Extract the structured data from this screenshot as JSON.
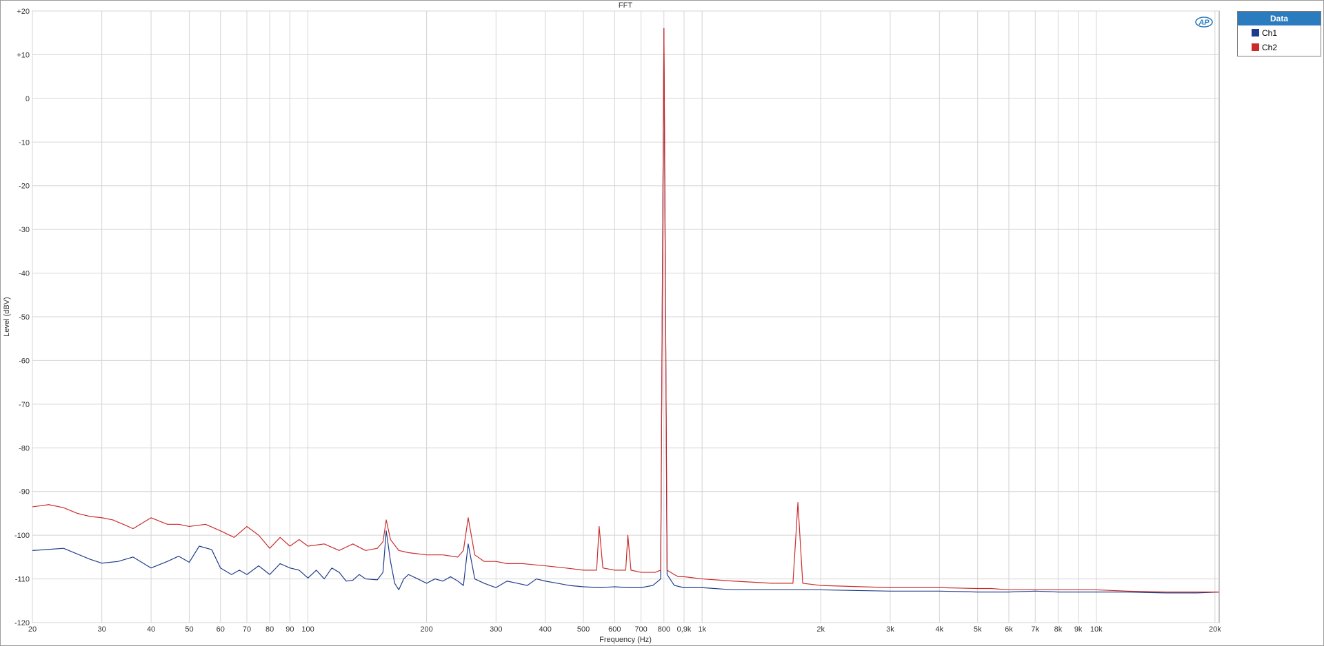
{
  "chart_data": {
    "type": "line",
    "title": "FFT",
    "xlabel": "Frequency (Hz)",
    "ylabel": "Level (dBV)",
    "x_scale": "log",
    "xlim": [
      20,
      20500
    ],
    "ylim": [
      -120,
      20
    ],
    "grid": true,
    "legend_position": "top-right-outside",
    "legend_title": "Data",
    "x_ticks": [
      {
        "value": 20,
        "label": "20"
      },
      {
        "value": 30,
        "label": "30"
      },
      {
        "value": 40,
        "label": "40"
      },
      {
        "value": 50,
        "label": "50"
      },
      {
        "value": 60,
        "label": "60"
      },
      {
        "value": 70,
        "label": "70"
      },
      {
        "value": 80,
        "label": "80"
      },
      {
        "value": 90,
        "label": "90"
      },
      {
        "value": 100,
        "label": "100"
      },
      {
        "value": 200,
        "label": "200"
      },
      {
        "value": 300,
        "label": "300"
      },
      {
        "value": 400,
        "label": "400"
      },
      {
        "value": 500,
        "label": "500"
      },
      {
        "value": 600,
        "label": "600"
      },
      {
        "value": 700,
        "label": "700"
      },
      {
        "value": 800,
        "label": "800"
      },
      {
        "value": 900,
        "label": "0,9k"
      },
      {
        "value": 1000,
        "label": "1k"
      },
      {
        "value": 2000,
        "label": "2k"
      },
      {
        "value": 3000,
        "label": "3k"
      },
      {
        "value": 4000,
        "label": "4k"
      },
      {
        "value": 5000,
        "label": "5k"
      },
      {
        "value": 6000,
        "label": "6k"
      },
      {
        "value": 7000,
        "label": "7k"
      },
      {
        "value": 8000,
        "label": "8k"
      },
      {
        "value": 9000,
        "label": "9k"
      },
      {
        "value": 10000,
        "label": "10k"
      },
      {
        "value": 20000,
        "label": "20k"
      }
    ],
    "y_ticks": [
      {
        "value": 20,
        "label": "+20"
      },
      {
        "value": 10,
        "label": "+10"
      },
      {
        "value": 0,
        "label": "0"
      },
      {
        "value": -10,
        "label": "-10"
      },
      {
        "value": -20,
        "label": "-20"
      },
      {
        "value": -30,
        "label": "-30"
      },
      {
        "value": -40,
        "label": "-40"
      },
      {
        "value": -50,
        "label": "-50"
      },
      {
        "value": -60,
        "label": "-60"
      },
      {
        "value": -70,
        "label": "-70"
      },
      {
        "value": -80,
        "label": "-80"
      },
      {
        "value": -90,
        "label": "-90"
      },
      {
        "value": -100,
        "label": "-100"
      },
      {
        "value": -110,
        "label": "-110"
      },
      {
        "value": -120,
        "label": "-120"
      }
    ],
    "series": [
      {
        "name": "Ch1",
        "color": "#1f3a8a",
        "x": [
          20,
          24,
          28,
          30,
          33,
          36,
          40,
          44,
          47,
          50,
          53,
          57,
          60,
          64,
          67,
          70,
          75,
          80,
          85,
          90,
          95,
          100,
          105,
          110,
          115,
          120,
          125,
          130,
          135,
          140,
          150,
          155,
          158,
          162,
          166,
          170,
          175,
          180,
          190,
          200,
          210,
          220,
          230,
          240,
          248,
          255,
          265,
          280,
          300,
          320,
          340,
          360,
          380,
          400,
          430,
          460,
          500,
          550,
          600,
          650,
          700,
          750,
          785,
          800,
          815,
          850,
          900,
          1000,
          1200,
          1500,
          2000,
          3000,
          4000,
          5000,
          6000,
          7000,
          8000,
          9000,
          10000,
          12000,
          15000,
          18000,
          20500
        ],
        "y": [
          -103.5,
          -103.0,
          -105.5,
          -106.4,
          -106.0,
          -105.0,
          -107.5,
          -106.0,
          -104.8,
          -106.2,
          -102.5,
          -103.3,
          -107.5,
          -109.0,
          -108.0,
          -109.0,
          -107.0,
          -109.0,
          -106.5,
          -107.5,
          -108.0,
          -109.8,
          -108.0,
          -110.0,
          -107.5,
          -108.5,
          -110.5,
          -110.3,
          -109.0,
          -110.0,
          -110.2,
          -108.5,
          -99.0,
          -106.0,
          -111.0,
          -112.5,
          -110.0,
          -109.0,
          -110.0,
          -111.0,
          -110.0,
          -110.5,
          -109.5,
          -110.5,
          -111.5,
          -102.0,
          -110.0,
          -111.0,
          -112.0,
          -110.5,
          -111.0,
          -111.5,
          -110.0,
          -110.5,
          -111.0,
          -111.5,
          -111.8,
          -112.0,
          -111.8,
          -112.0,
          -112.0,
          -111.5,
          -110.0,
          16.0,
          -109.0,
          -111.5,
          -112.0,
          -112.0,
          -112.5,
          -112.5,
          -112.5,
          -112.8,
          -112.8,
          -113.0,
          -113.0,
          -112.8,
          -113.0,
          -113.0,
          -113.0,
          -113.0,
          -113.2,
          -113.2,
          -113.0
        ]
      },
      {
        "name": "Ch2",
        "color": "#cc2b2b",
        "x": [
          20,
          22,
          24,
          26,
          28,
          30,
          32,
          34,
          36,
          40,
          44,
          47,
          50,
          55,
          60,
          65,
          70,
          75,
          80,
          85,
          90,
          95,
          100,
          110,
          120,
          130,
          140,
          150,
          155,
          158,
          162,
          170,
          180,
          200,
          220,
          240,
          248,
          255,
          265,
          280,
          300,
          320,
          350,
          400,
          450,
          500,
          540,
          548,
          560,
          600,
          640,
          648,
          660,
          700,
          760,
          785,
          800,
          815,
          850,
          870,
          900,
          1000,
          1200,
          1500,
          1700,
          1750,
          1800,
          2000,
          3000,
          4000,
          5000,
          5400,
          6000,
          7000,
          8000,
          9000,
          10000,
          12000,
          15000,
          18000,
          20500
        ],
        "y": [
          -93.5,
          -93.0,
          -93.7,
          -95.0,
          -95.7,
          -96.0,
          -96.5,
          -97.5,
          -98.5,
          -96.0,
          -97.5,
          -97.5,
          -98.0,
          -97.5,
          -99.0,
          -100.5,
          -98.0,
          -100.0,
          -103.0,
          -100.5,
          -102.5,
          -101.0,
          -102.5,
          -102.0,
          -103.5,
          -102.0,
          -103.5,
          -103.0,
          -101.5,
          -96.5,
          -101.0,
          -103.5,
          -104.0,
          -104.5,
          -104.5,
          -105.0,
          -103.5,
          -96.0,
          -104.5,
          -106.0,
          -106.0,
          -106.5,
          -106.5,
          -107.0,
          -107.5,
          -108.0,
          -108.0,
          -98.0,
          -107.5,
          -108.0,
          -108.0,
          -100.0,
          -108.0,
          -108.5,
          -108.5,
          -108.0,
          16.0,
          -108.0,
          -109.0,
          -109.5,
          -109.5,
          -110.0,
          -110.5,
          -111.0,
          -111.0,
          -92.5,
          -111.0,
          -111.5,
          -112.0,
          -112.0,
          -112.2,
          -112.2,
          -112.5,
          -112.5,
          -112.5,
          -112.5,
          -112.5,
          -112.8,
          -113.0,
          -113.0,
          -113.0
        ]
      }
    ],
    "annotations": [
      {
        "text": "Prominent line near 800 Hz reaching about +16 dBV",
        "hidden": true
      }
    ]
  },
  "logo": {
    "text": "AP"
  }
}
